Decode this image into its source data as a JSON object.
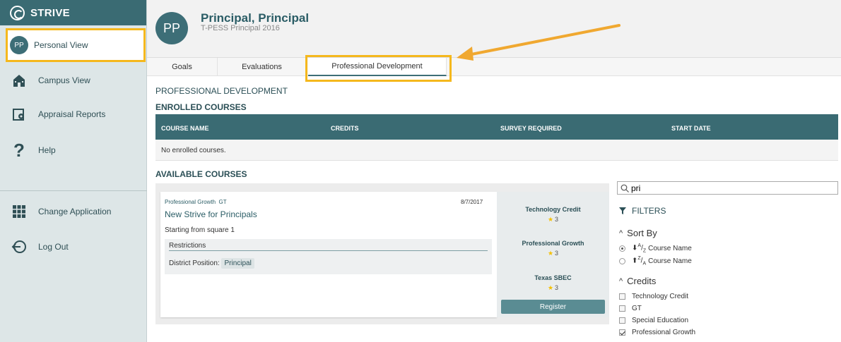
{
  "brand": {
    "name": "STRIVE"
  },
  "sidebar": {
    "items": [
      {
        "label": "Personal View",
        "avatar": "PP"
      },
      {
        "label": "Campus View"
      },
      {
        "label": "Appraisal Reports"
      },
      {
        "label": "Help"
      },
      {
        "label": "Change Application"
      },
      {
        "label": "Log Out"
      }
    ]
  },
  "header": {
    "avatar": "PP",
    "name": "Principal, Principal",
    "subtitle": "T-PESS Principal 2016"
  },
  "tabs": [
    {
      "label": "Goals"
    },
    {
      "label": "Evaluations"
    },
    {
      "label": "Professional Development"
    }
  ],
  "main": {
    "section_title": "PROFESSIONAL DEVELOPMENT",
    "enrolled": {
      "title": "ENROLLED COURSES",
      "columns": [
        "COURSE NAME",
        "CREDITS",
        "SURVEY REQUIRED",
        "START DATE"
      ],
      "empty_text": "No enrolled courses."
    },
    "available": {
      "title": "AVAILABLE COURSES",
      "course": {
        "category": "Professional Growth",
        "tag": "GT",
        "date": "8/7/2017",
        "name": "New Strive for Principals",
        "description": "Starting from square 1",
        "restrictions_label": "Restrictions",
        "district_position_label": "District Position:",
        "district_position_value": "Principal",
        "credits": [
          {
            "name": "Technology Credit",
            "value": "3"
          },
          {
            "name": "Professional Growth",
            "value": "3"
          },
          {
            "name": "Texas SBEC",
            "value": "3"
          }
        ],
        "register_label": "Register"
      }
    }
  },
  "filters": {
    "search_value": "pri",
    "title": "FILTERS",
    "sort_by": {
      "title": "Sort By",
      "options": [
        {
          "label": "Course Name",
          "prefix": "A/Z",
          "checked": true
        },
        {
          "label": "Course Name",
          "prefix": "Z/A",
          "checked": false
        }
      ]
    },
    "credits": {
      "title": "Credits",
      "options": [
        {
          "label": "Technology Credit",
          "checked": false
        },
        {
          "label": "GT",
          "checked": false
        },
        {
          "label": "Special Education",
          "checked": false
        },
        {
          "label": "Professional Growth",
          "checked": true
        }
      ]
    }
  },
  "colors": {
    "accent": "#3a6b73",
    "highlight": "#f5b81d",
    "arrow": "#f0a830"
  }
}
